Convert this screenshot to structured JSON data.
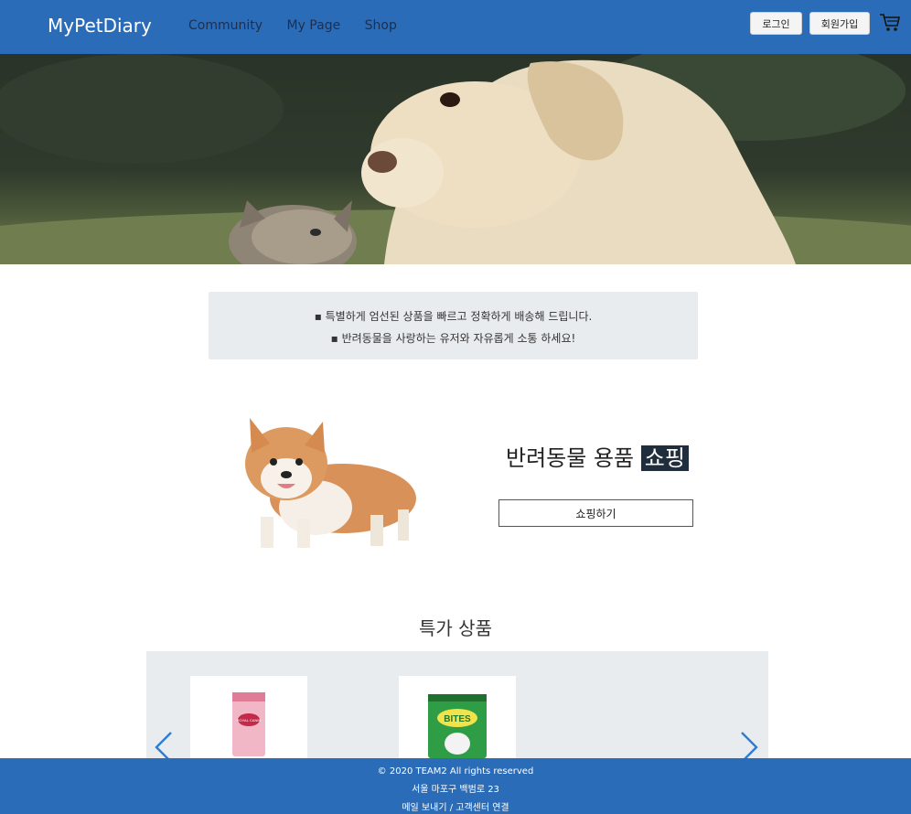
{
  "header": {
    "brand": "MyPetDiary",
    "nav": [
      "Community",
      "My Page",
      "Shop"
    ],
    "login_label": "로그인",
    "signup_label": "회원가입",
    "cart_icon": "cart-icon"
  },
  "notice": {
    "line1": "▪ 특별하게 엄선된 상품을 빠르고 정확하게 배송해 드립니다.",
    "line2": "▪ 반려동물을 사랑하는 유저와 자유롭게 소통 하세요!"
  },
  "shopping": {
    "title_prefix": "반려동물 용품",
    "title_highlight": "쇼핑",
    "button_label": "쇼핑하기"
  },
  "special": {
    "title": "특가 상품",
    "products": [
      {
        "brand_text": "ROYAL CANIN"
      },
      {
        "brand_text": "BITES"
      }
    ]
  },
  "footer": {
    "copyright": "© 2020 TEAM2 All rights reserved",
    "address": "서울 마포구 백범로 23",
    "links": "메일 보내기 / 고객센터 연결"
  },
  "colors": {
    "header_bg": "#2b6cb8",
    "footer_bg": "#2b6cb8",
    "notice_bg": "#e9ecef",
    "highlight_bg": "#1f2d3d",
    "arrow": "#2b7cd6"
  }
}
